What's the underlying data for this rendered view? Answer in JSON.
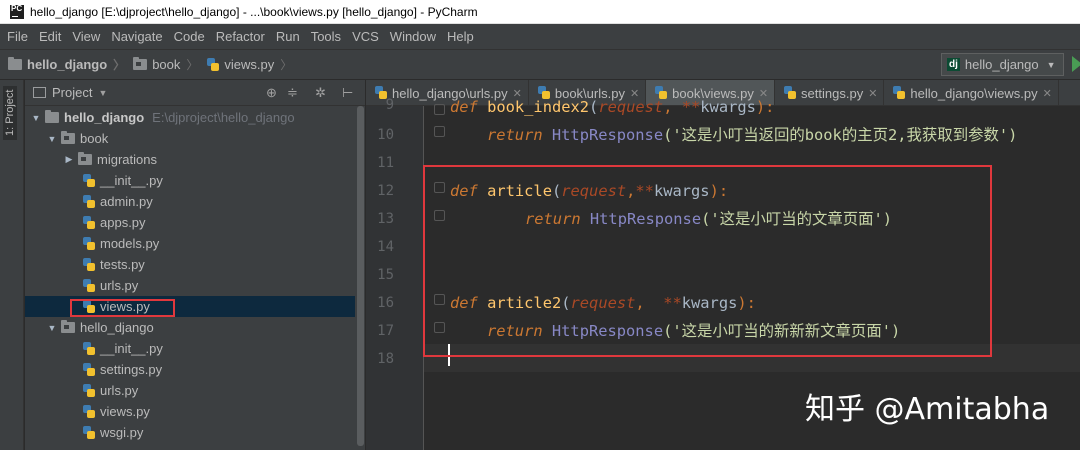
{
  "window": {
    "title": "hello_django [E:\\djproject\\hello_django] - ...\\book\\views.py [hello_django] - PyCharm",
    "app_icon_text": "PC"
  },
  "menu": [
    "File",
    "Edit",
    "View",
    "Navigate",
    "Code",
    "Refactor",
    "Run",
    "Tools",
    "VCS",
    "Window",
    "Help"
  ],
  "breadcrumb": [
    "hello_django",
    "book",
    "views.py"
  ],
  "run_config": "hello_django",
  "stripe_label": "1: Project",
  "project": {
    "header": "Project",
    "tree": [
      {
        "label": "hello_django",
        "extra": "E:\\djproject\\hello_django"
      },
      {
        "label": "book"
      },
      {
        "label": "migrations"
      },
      {
        "label": "__init__.py"
      },
      {
        "label": "admin.py"
      },
      {
        "label": "apps.py"
      },
      {
        "label": "models.py"
      },
      {
        "label": "tests.py"
      },
      {
        "label": "urls.py"
      },
      {
        "label": "views.py"
      },
      {
        "label": "hello_django"
      },
      {
        "label": "__init__.py"
      },
      {
        "label": "settings.py"
      },
      {
        "label": "urls.py"
      },
      {
        "label": "views.py"
      },
      {
        "label": "wsgi.py"
      }
    ]
  },
  "tabs": [
    "hello_django\\urls.py",
    "book\\urls.py",
    "book\\views.py",
    "settings.py",
    "hello_django\\views.py"
  ],
  "active_tab": "book\\views.py",
  "line_numbers": [
    "9",
    "10",
    "11",
    "12",
    "13",
    "14",
    "15",
    "16",
    "17",
    "18"
  ],
  "code": {
    "l9": {
      "kw": "def",
      "name": "book_index2",
      "open": "(",
      "p1": "request",
      "comma": ", ",
      "star": "**",
      "p2": "kwargs",
      "close": "):"
    },
    "l10": {
      "kw": "return",
      "call": "HttpResponse",
      "str": "('这是小叮当返回的book的主页2,我获取到参数')"
    },
    "l12": {
      "kw": "def",
      "name": "article",
      "open": "(",
      "p1": "request",
      "comma": ",",
      "star": "**",
      "p2": "kwargs",
      "close": "):"
    },
    "l13": {
      "kw": "return",
      "call": "HttpResponse",
      "str": "('这是小叮当的文章页面')"
    },
    "l16": {
      "kw": "def",
      "name": "article2",
      "open": "(",
      "p1": "request",
      "comma": ",  ",
      "star": "**",
      "p2": "kwargs",
      "close": "):"
    },
    "l17": {
      "kw": "return",
      "call": "HttpResponse",
      "str": "('这是小叮当的新新新文章页面')"
    }
  },
  "watermark": "知乎 @Amitabha",
  "colors": {
    "red_box": "#e0383d",
    "keyword": "#cc7832",
    "function": "#ffc66d",
    "string": "#6a8759"
  }
}
